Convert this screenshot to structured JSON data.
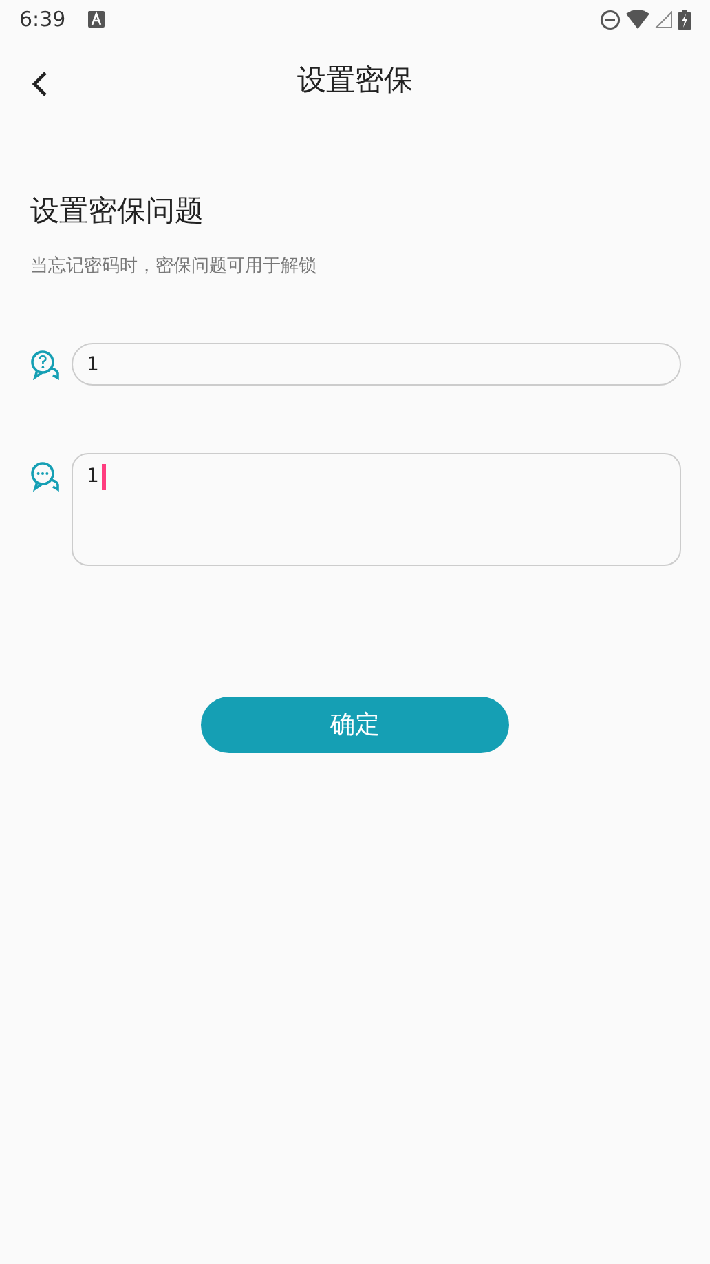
{
  "status_bar": {
    "time": "6:39"
  },
  "header": {
    "title": "设置密保"
  },
  "section": {
    "heading": "设置密保问题",
    "hint": "当忘记密码时，密保问题可用于解锁"
  },
  "question": {
    "value": "1"
  },
  "answer": {
    "value": "1",
    "focused": true
  },
  "confirm_button": {
    "label": "确定"
  }
}
